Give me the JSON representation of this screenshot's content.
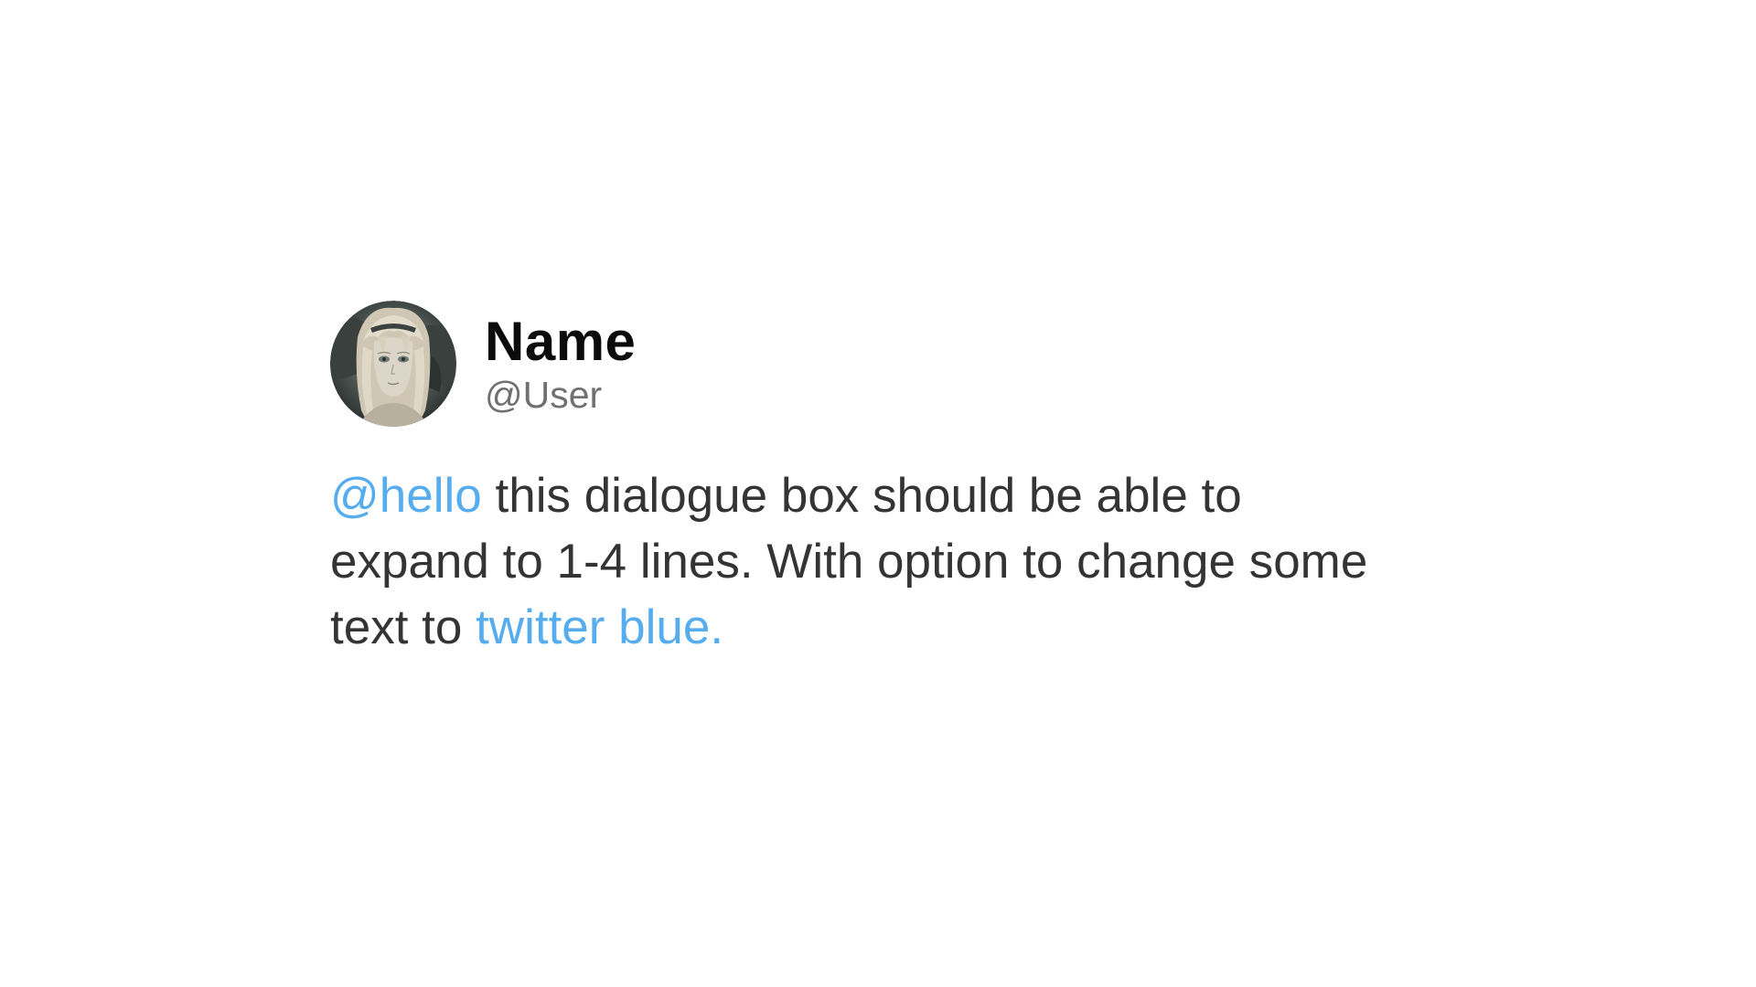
{
  "colors": {
    "accent": "#55acee",
    "text": "#343434",
    "name": "#0b0b0b",
    "handle": "#707070",
    "background": "#ffffff"
  },
  "profile": {
    "avatar_alt": "avatar",
    "display_name": "Name",
    "handle": "@User"
  },
  "tweet": {
    "mention": "@hello",
    "text_part1": " this dialogue box should be able to expand to 1-4 lines. With option to change some text to ",
    "highlight": "twitter blue."
  }
}
